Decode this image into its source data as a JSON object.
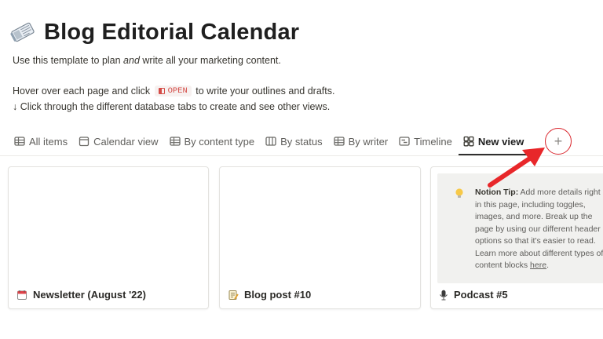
{
  "page": {
    "title": "Blog Editorial Calendar",
    "title_icon": "newspaper-icon"
  },
  "description": {
    "line1_pre": "Use this template to plan ",
    "line1_em": "and",
    "line1_post": " write all your marketing content.",
    "line2_pre": "Hover over each page and click ",
    "line2_chip": "OPEN",
    "line2_post": " to write your outlines and drafts.",
    "line3": "↓ Click through the different database tabs to create and see other views."
  },
  "tabs": [
    {
      "label": "All items",
      "icon": "table-icon",
      "active": false
    },
    {
      "label": "Calendar view",
      "icon": "calendar-icon",
      "active": false
    },
    {
      "label": "By content type",
      "icon": "table-icon",
      "active": false
    },
    {
      "label": "By status",
      "icon": "board-icon",
      "active": false
    },
    {
      "label": "By writer",
      "icon": "table-icon",
      "active": false
    },
    {
      "label": "Timeline",
      "icon": "timeline-icon",
      "active": false
    },
    {
      "label": "New view",
      "icon": "gallery-icon",
      "active": true
    }
  ],
  "add_view_label": "+",
  "cards": [
    {
      "title": "Newsletter (August '22)",
      "icon": "calendar-page-icon"
    },
    {
      "title": "Blog post #10",
      "icon": "memo-icon"
    },
    {
      "title": "Podcast #5",
      "icon": "microphone-icon"
    }
  ],
  "tip": {
    "bold": "Notion Tip:",
    "text": " Add more details right in this page, including toggles, images, and more. Break up the page by using our different header options so that it's easier to read. Learn more about different types of content blocks ",
    "link": "here",
    "end": ".",
    "icon": "lightbulb-icon"
  },
  "colors": {
    "accent_red": "#d9232a",
    "chip_red": "#d44c47",
    "text": "#37352f"
  }
}
